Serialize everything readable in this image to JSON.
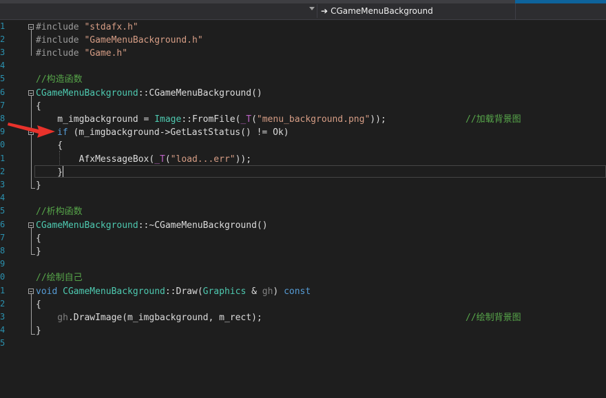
{
  "toolbar": {
    "member_arrow": "➔",
    "member_name": "CGameMenuBackground"
  },
  "line_numbers": [
    "1",
    "2",
    "3",
    "4",
    "5",
    "6",
    "7",
    "8",
    "9",
    "0",
    "1",
    "2",
    "3",
    "4",
    "5",
    "6",
    "7",
    "8",
    "9",
    "0",
    "1",
    "2",
    "3",
    "4",
    "5"
  ],
  "code": {
    "l1_pre": "#include ",
    "l1_str": "\"stdafx.h\"",
    "l2_pre": "#include ",
    "l2_str": "\"GameMenuBackground.h\"",
    "l3_pre": "#include ",
    "l3_str": "\"Game.h\"",
    "l5_cmt": "//构造函数",
    "l6_type": "CGameMenuBackground",
    "l6_rest": "::CGameMenuBackground()",
    "l7": "{",
    "l8_var": "    m_imgbackground = ",
    "l8_type": "Image",
    "l8_mid": "::FromFile(",
    "l8_mac": "_T",
    "l8_paren": "(",
    "l8_str": "\"menu_background.png\"",
    "l8_end": "));",
    "l8_cmt": "//加载背景图",
    "l9_kw": "if",
    "l9_rest": " (m_imgbackground->GetLastStatus() != Ok)",
    "l10": "    {",
    "l11_fn": "        AfxMessageBox(",
    "l11_mac": "_T",
    "l11_paren": "(",
    "l11_str": "\"load...err\"",
    "l11_end": "));",
    "l12": "    }",
    "l13": "}",
    "l15_cmt": "//析构函数",
    "l16_type": "CGameMenuBackground",
    "l16_rest": "::~CGameMenuBackground()",
    "l17": "{",
    "l18": "}",
    "l20_cmt": "//绘制自己",
    "l21_kw": "void",
    "l21_sp": " ",
    "l21_type": "CGameMenuBackground",
    "l21_mid": "::Draw(",
    "l21_type2": "Graphics",
    "l21_amp": " & ",
    "l21_param": "gh",
    "l21_close": ") ",
    "l21_kw2": "const",
    "l22": "{",
    "l23_param": "    gh",
    "l23_rest": ".DrawImage(m_imgbackground, m_rect);",
    "l23_cmt": "//绘制背景图",
    "l24": "}"
  }
}
